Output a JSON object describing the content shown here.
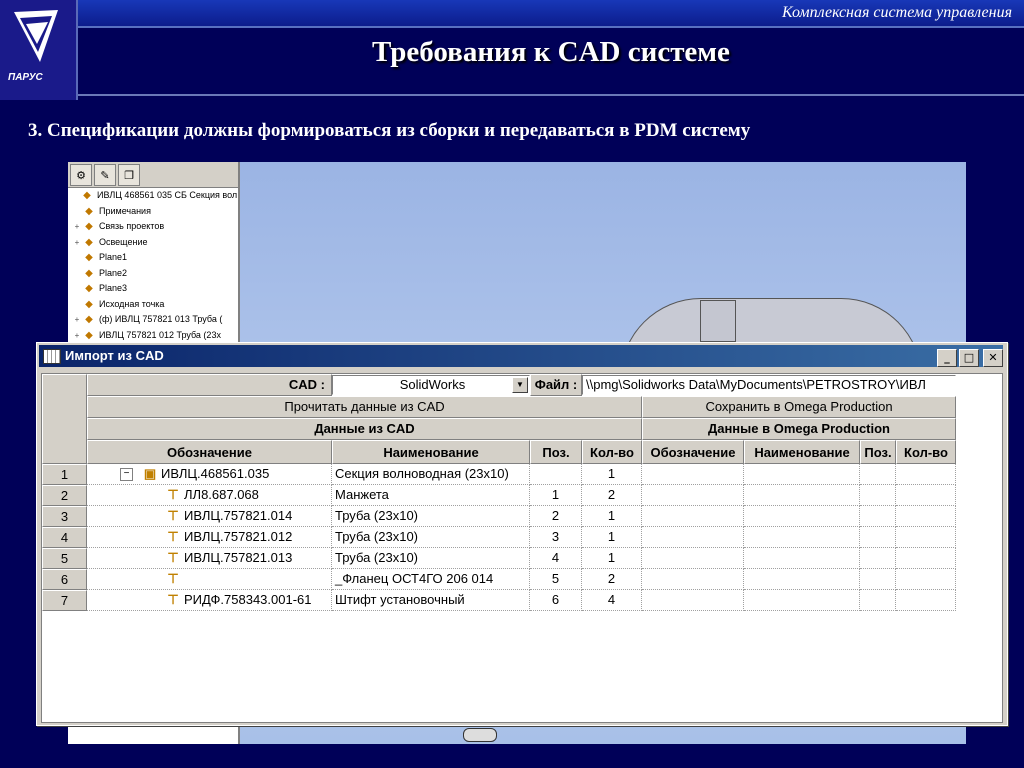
{
  "header": {
    "company": "Комплексная система управления",
    "title": "Требования к CAD системе",
    "logo_text": "ПАРУС"
  },
  "subtitle": "3. Спецификации должны формироваться из сборки и передаваться в PDM систему",
  "tree": {
    "items": [
      {
        "label": "ИВЛЦ 468561 035 СБ Секция вол",
        "expander": "",
        "indent": 0
      },
      {
        "label": "Примечания",
        "expander": "",
        "indent": 1
      },
      {
        "label": "Связь проектов",
        "expander": "+",
        "indent": 1
      },
      {
        "label": "Освещение",
        "expander": "+",
        "indent": 1
      },
      {
        "label": "Plane1",
        "expander": "",
        "indent": 1
      },
      {
        "label": "Plane2",
        "expander": "",
        "indent": 1
      },
      {
        "label": "Plane3",
        "expander": "",
        "indent": 1
      },
      {
        "label": "Исходная точка",
        "expander": "",
        "indent": 1
      },
      {
        "label": "(ф) ИВЛЦ 757821 013 Труба (",
        "expander": "+",
        "indent": 1
      },
      {
        "label": "ИВЛЦ 757821 012 Труба (23х",
        "expander": "+",
        "indent": 1
      }
    ]
  },
  "dialog": {
    "title": "Импорт из CAD",
    "buttons": {
      "minimize": "_",
      "maximize": "□",
      "close": "✕"
    },
    "cad_label": "CAD :",
    "cad_value": "SolidWorks",
    "file_label": "Файл :",
    "file_value": "\\\\pmg\\Solidworks Data\\MyDocuments\\PETROSTROY\\ИВЛ",
    "read_button": "Прочитать данные из CAD",
    "save_button": "Сохранить в Omega Production",
    "cad_section": "Данные из CAD",
    "omega_section": "Данные в Omega Production",
    "columns": {
      "designation": "Обозначение",
      "name": "Наименование",
      "pos": "Поз.",
      "qty": "Кол-во",
      "o_designation": "Обозначение",
      "o_name": "Наименование",
      "o_pos": "Поз.",
      "o_qty": "Кол-во"
    },
    "rows": [
      {
        "n": "1",
        "designation": "ИВЛЦ.468561.035",
        "name": "Секция волноводная (23х10)",
        "pos": "",
        "qty": "1",
        "assembly": true
      },
      {
        "n": "2",
        "designation": "ЛЛ8.687.068",
        "name": "Манжета",
        "pos": "1",
        "qty": "2",
        "assembly": false
      },
      {
        "n": "3",
        "designation": "ИВЛЦ.757821.014",
        "name": "Труба (23х10)",
        "pos": "2",
        "qty": "1",
        "assembly": false
      },
      {
        "n": "4",
        "designation": "ИВЛЦ.757821.012",
        "name": "Труба (23х10)",
        "pos": "3",
        "qty": "1",
        "assembly": false
      },
      {
        "n": "5",
        "designation": "ИВЛЦ.757821.013",
        "name": "Труба (23х10)",
        "pos": "4",
        "qty": "1",
        "assembly": false
      },
      {
        "n": "6",
        "designation": "",
        "name": "_Фланец ОСТ4ГО 206 014",
        "pos": "5",
        "qty": "2",
        "assembly": false
      },
      {
        "n": "7",
        "designation": "РИДФ.758343.001-61",
        "name": "Штифт установочный",
        "pos": "6",
        "qty": "4",
        "assembly": false
      }
    ]
  }
}
